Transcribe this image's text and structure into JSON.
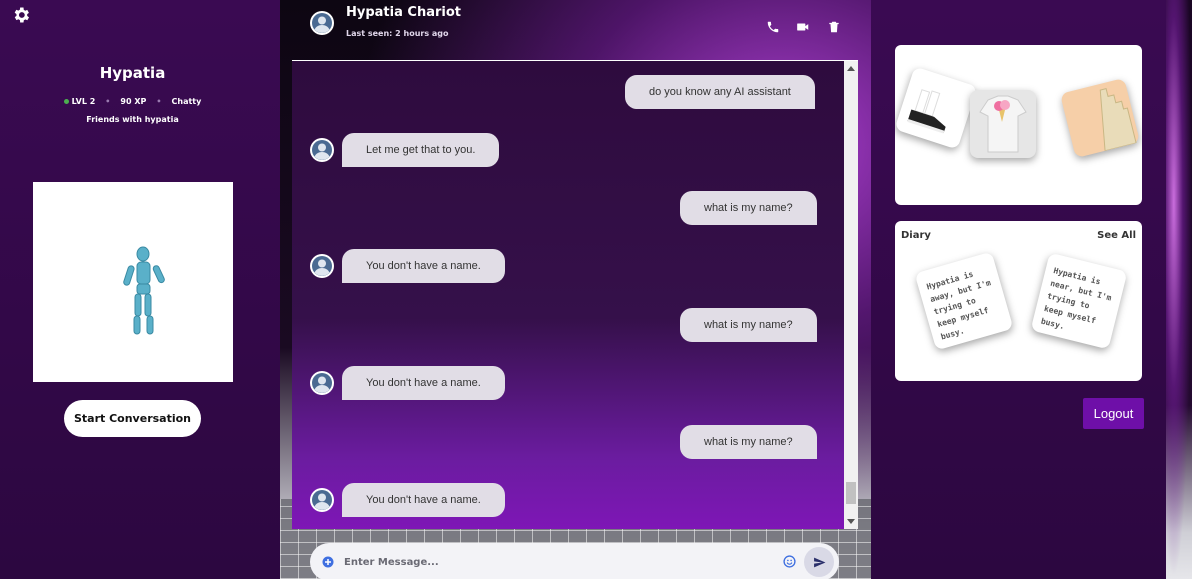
{
  "colors": {
    "background": "#2c0740",
    "accent": "#6e0fa8",
    "bubble": "#e1dde6",
    "level_dot": "#4caf50"
  },
  "settings": {
    "icon": "gear-icon"
  },
  "profile": {
    "name": "Hypatia",
    "level": "LVL 2",
    "xp": "90 XP",
    "mood": "Chatty",
    "friendship": "Friends with hypatia",
    "start_label": "Start Conversation"
  },
  "chat": {
    "contact_name": "Hypatia Chariot",
    "last_seen": "Last seen: 2 hours ago",
    "header_icons": [
      "phone-icon",
      "video-camera-icon",
      "trash-icon"
    ],
    "messages": [
      {
        "from": "me",
        "text": "do you know any AI assistant"
      },
      {
        "from": "bot",
        "text": "Let me get that to you."
      },
      {
        "from": "me",
        "text": "what is my name?"
      },
      {
        "from": "bot",
        "text": "You don't have a name."
      },
      {
        "from": "me",
        "text": "what is my name?"
      },
      {
        "from": "bot",
        "text": "You don't have a name."
      },
      {
        "from": "me",
        "text": "what is my name?"
      },
      {
        "from": "bot",
        "text": "You don't have a name."
      }
    ],
    "input_placeholder": "Enter Message..."
  },
  "closet": {
    "items": [
      "sneakers",
      "ice-cream t-shirt",
      "golden staircase"
    ]
  },
  "diary": {
    "title": "Diary",
    "see_all": "See All",
    "notes": [
      "Hypatia is away, but I'm trying to keep myself busy.",
      "Hypatia is near, but I'm trying to keep myself busy."
    ]
  },
  "logout_label": "Logout"
}
